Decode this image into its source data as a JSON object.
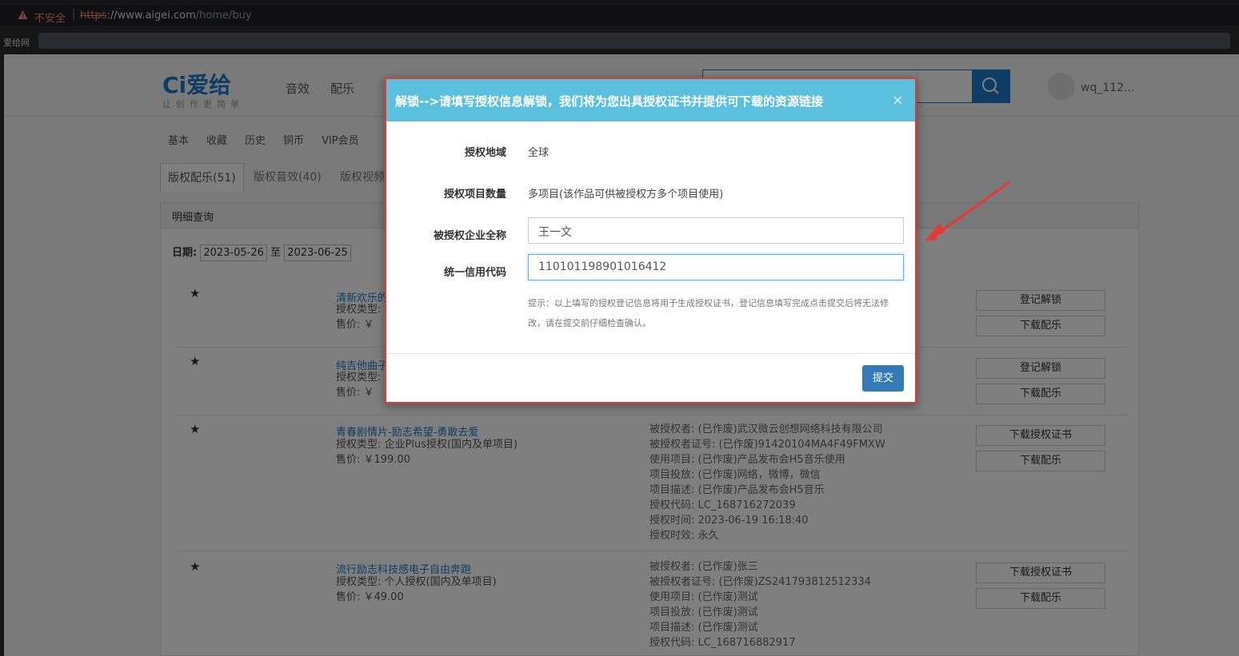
{
  "browser": {
    "insecure_label": "不安全",
    "url_scheme": "https",
    "url_host": "://www.aigei.com",
    "url_path": "/home/buy",
    "bookmark_site": "爱给网"
  },
  "header": {
    "logo_text": "Ci爱给",
    "slogan": "让创作更简单",
    "nav": [
      "音效",
      "配乐"
    ],
    "username": "wq_112..."
  },
  "subnav": [
    "基本",
    "收藏",
    "历史",
    "铜币",
    "VIP会员"
  ],
  "tabs": [
    "版权配乐(51)",
    "版权音效(40)",
    "版权视频"
  ],
  "panel": {
    "title": "明细查询",
    "date_label": "日期:",
    "date_from": "2023-05-26",
    "date_to_sep": "至",
    "date_to": "2023-06-25"
  },
  "rows": [
    {
      "title": "清新欢乐的",
      "license_type": "授权类型:",
      "price": "售价: ￥",
      "buttons": [
        "登记解锁",
        "下载配乐"
      ]
    },
    {
      "title": "纯吉他曲子",
      "license_type": "授权类型:",
      "price": "售价: ￥",
      "buttons": [
        "登记解锁",
        "下载配乐"
      ]
    },
    {
      "title": "青春剧情片-励志希望-勇敢去爱",
      "license_type": "授权类型: 企业Plus授权(国内及单项目)",
      "price": "售价: ￥199.00",
      "details": [
        "被授权者: (已作废)武汉微云创想网络科技有限公司",
        "被授权者证号: (已作废)91420104MA4F49FMXW",
        "使用项目: (已作废)产品发布会H5音乐使用",
        "项目投放: (已作废)网络，微博，微信",
        "项目描述: (已作废)产品发布会H5音乐",
        "授权代码: LC_168716272039",
        "授权时间: 2023-06-19 16:18:40",
        "授权时效: 永久"
      ],
      "buttons": [
        "下载授权证书",
        "下载配乐"
      ]
    },
    {
      "title": "流行励志科技感电子自由奔跑",
      "license_type": "授权类型: 个人授权(国内及单项目)",
      "price": "售价: ￥49.00",
      "details": [
        "被授权者: (已作废)张三",
        "被授权者证号: (已作废)ZS241793812512334",
        "使用项目: (已作废)测试",
        "项目投放: (已作废)测试",
        "项目描述: (已作废)测试",
        "授权代码: LC_168716882917"
      ],
      "buttons": [
        "下载授权证书",
        "下载配乐"
      ]
    }
  ],
  "modal": {
    "title": "解锁-->请填写授权信息解锁，我们将为您出具授权证书并提供可下载的资源链接",
    "close": "×",
    "fields": [
      {
        "label": "授权地域",
        "value": "全球"
      },
      {
        "label": "授权项目数量",
        "value": "多项目(该作品可供被授权方多个项目使用)"
      },
      {
        "label": "被授权企业全称",
        "value": "王一文"
      },
      {
        "label": "统一信用代码",
        "value": "110101198901016412"
      }
    ],
    "hint": "提示：以上填写的授权登记信息将用于生成授权证书，登记信息填写完成点击提交后将无法修改，请在提交前仔细检查确认。",
    "submit_label": "提交"
  },
  "colors": {
    "accent": "#1a7bc8",
    "modal_header": "#5bc0de",
    "highlight_border": "#e53935",
    "submit": "#337ab7"
  }
}
